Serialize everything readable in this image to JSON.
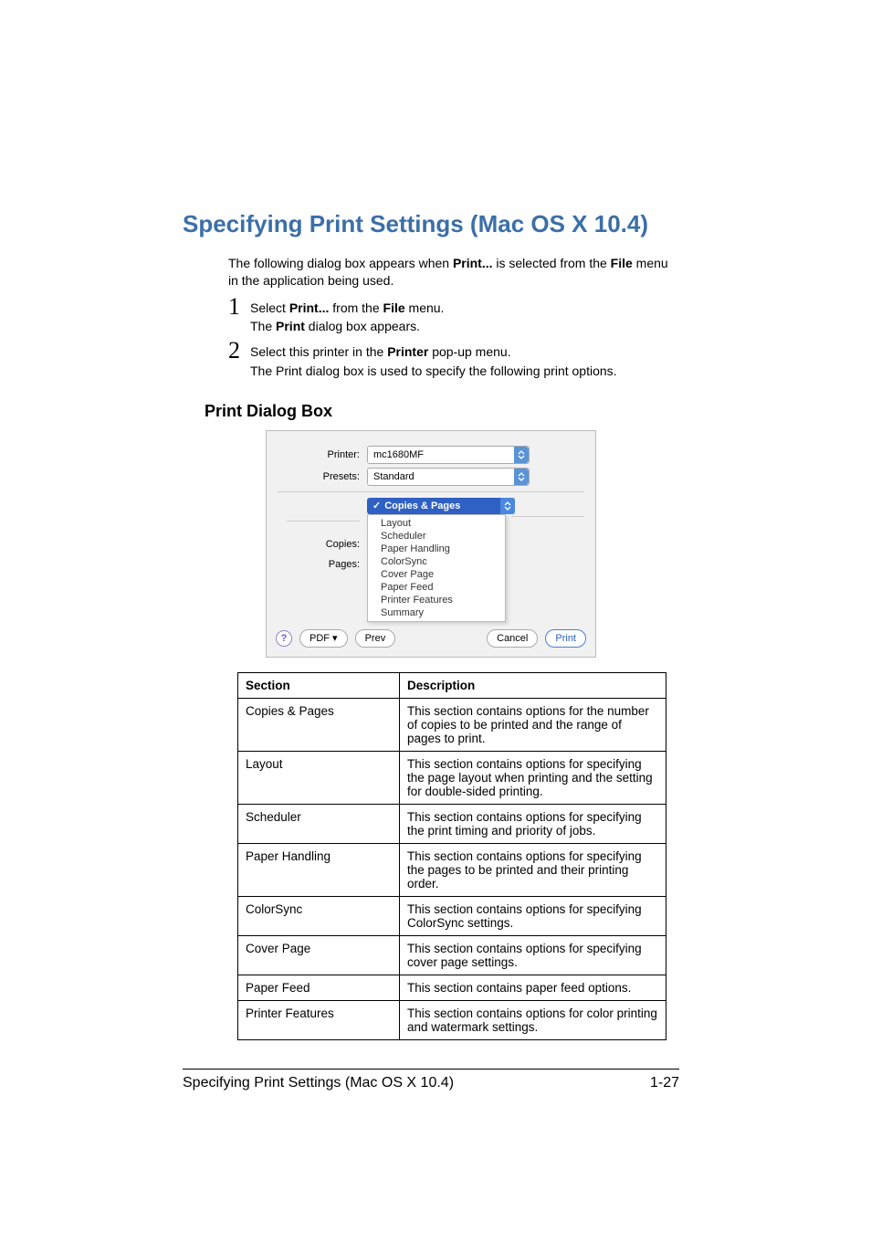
{
  "heading": "Specifying Print Settings (Mac OS X 10.4)",
  "intro": {
    "p1a": "The following dialog box appears when ",
    "p1b": "Print...",
    "p1c": " is selected from the ",
    "p1d": "File",
    "p1e": " menu in the application being used."
  },
  "steps": {
    "s1": {
      "num": "1",
      "a": "Select ",
      "b": "Print...",
      "c": " from the ",
      "d": "File",
      "e": " menu.",
      "line2a": "The ",
      "line2b": "Print",
      "line2c": " dialog box appears."
    },
    "s2": {
      "num": "2",
      "a": "Select this printer in the ",
      "b": "Printer",
      "c": " pop-up menu.",
      "line2": "The Print dialog box is used to specify the following print options."
    }
  },
  "subheading": "Print Dialog Box",
  "dialog": {
    "printer_label": "Printer:",
    "printer_value": "mc1680MF",
    "presets_label": "Presets:",
    "presets_value": "Standard",
    "copies_label": "Copies:",
    "pages_label": "Pages:",
    "selected_section": "Copies & Pages",
    "menu": [
      "Layout",
      "Scheduler",
      "Paper Handling",
      "ColorSync",
      "Cover Page",
      "Paper Feed",
      "Printer Features",
      "Summary"
    ],
    "pdf_btn": "PDF ▾",
    "prev_btn": "Prev",
    "cancel_btn": "Cancel",
    "print_btn": "Print"
  },
  "table": {
    "h1": "Section",
    "h2": "Description",
    "rows": [
      {
        "s": "Copies & Pages",
        "d": "This section contains options for the number of copies to be printed and the range of pages to print."
      },
      {
        "s": "Layout",
        "d": "This section contains options for specifying the page layout when printing and the setting for double-sided printing."
      },
      {
        "s": "Scheduler",
        "d": "This section contains options for specifying the print timing and priority of jobs."
      },
      {
        "s": "Paper Handling",
        "d": "This section contains options for specifying the pages to be printed and their printing order."
      },
      {
        "s": "ColorSync",
        "d": "This section contains options for specifying ColorSync settings."
      },
      {
        "s": "Cover Page",
        "d": "This section contains options for specifying cover page settings."
      },
      {
        "s": "Paper Feed",
        "d": "This section contains paper feed options."
      },
      {
        "s": "Printer Features",
        "d": "This section contains options for color printing and watermark settings."
      }
    ]
  },
  "footer": {
    "title": "Specifying Print Settings (Mac OS X 10.4)",
    "page": "1-27"
  }
}
